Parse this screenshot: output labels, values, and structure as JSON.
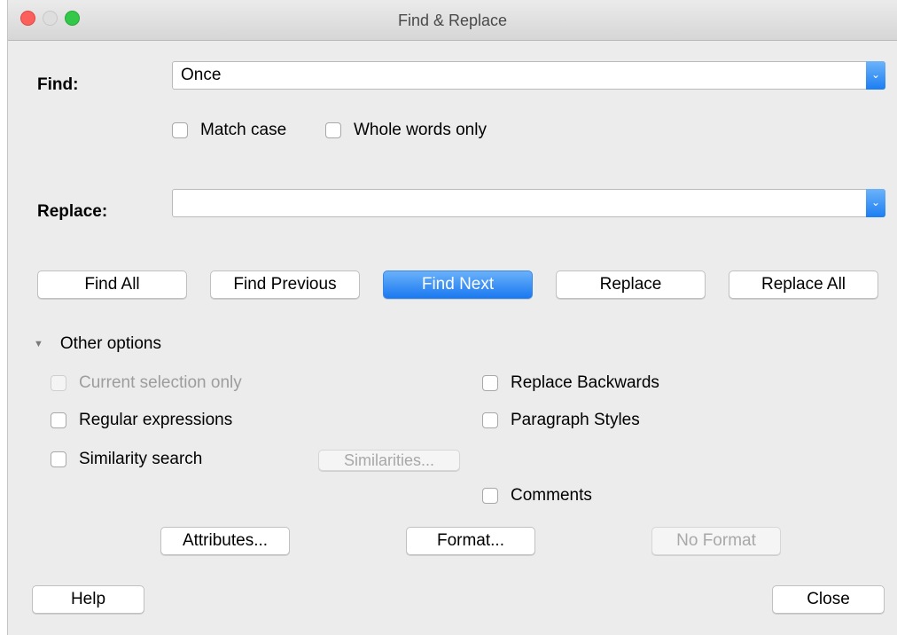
{
  "window": {
    "title": "Find & Replace"
  },
  "find": {
    "label": "Find:",
    "value": "Once"
  },
  "find_options": {
    "match_case": "Match case",
    "whole_words": "Whole words only"
  },
  "replace": {
    "label": "Replace:",
    "value": ""
  },
  "actions": {
    "find_all": "Find All",
    "find_previous": "Find Previous",
    "find_next": "Find Next",
    "replace": "Replace",
    "replace_all": "Replace All"
  },
  "other_options": {
    "label": "Other options",
    "current_selection_only": "Current selection only",
    "regular_expressions": "Regular expressions",
    "similarity_search": "Similarity search",
    "similarities_button": "Similarities...",
    "replace_backwards": "Replace Backwards",
    "paragraph_styles": "Paragraph Styles",
    "comments": "Comments",
    "attributes_button": "Attributes...",
    "format_button": "Format...",
    "no_format_button": "No Format"
  },
  "footer": {
    "help": "Help",
    "close": "Close"
  },
  "icons": {
    "dropdown": "chevron-down-icon",
    "disclosure": "disclosure-triangle-icon"
  },
  "colors": {
    "accent": "#1b79f0",
    "close_light": "#fc605c",
    "max_light": "#34c84a"
  }
}
